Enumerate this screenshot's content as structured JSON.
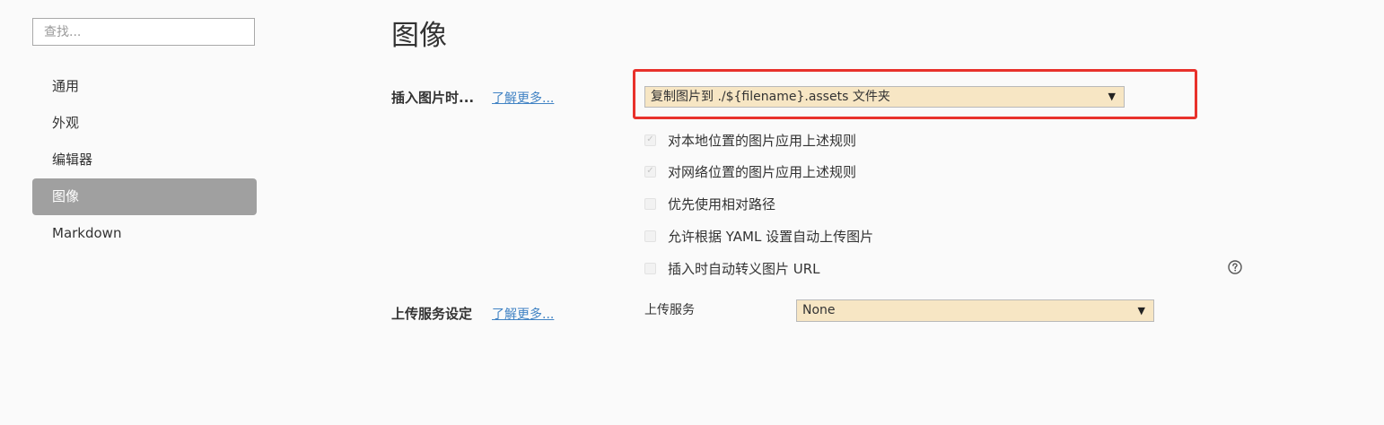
{
  "sidebar": {
    "search_placeholder": "查找...",
    "items": [
      {
        "label": "通用"
      },
      {
        "label": "外观"
      },
      {
        "label": "编辑器"
      },
      {
        "label": "图像",
        "active": true
      },
      {
        "label": "Markdown"
      }
    ]
  },
  "main": {
    "title": "图像",
    "insert_image": {
      "label": "插入图片时...",
      "learn_more": "了解更多...",
      "select_value": "复制图片到 ./${filename}.assets 文件夹",
      "options": [
        {
          "label": "对本地位置的图片应用上述规则",
          "checked": true,
          "disabled": true
        },
        {
          "label": "对网络位置的图片应用上述规则",
          "checked": true,
          "disabled": true
        },
        {
          "label": "优先使用相对路径",
          "checked": false,
          "disabled": true
        },
        {
          "label": "允许根据 YAML 设置自动上传图片",
          "checked": false,
          "disabled": true
        },
        {
          "label": "插入时自动转义图片 URL",
          "checked": false,
          "disabled": true
        }
      ]
    },
    "upload": {
      "label": "上传服务设定",
      "learn_more": "了解更多...",
      "field_label": "上传服务",
      "select_value": "None"
    }
  },
  "icons": {
    "dropdown": "caret-down-icon",
    "help": "question-circle-icon",
    "check": "checkmark-icon"
  },
  "colors": {
    "highlight": "#e8312b",
    "select_bg": "#f7e6c4",
    "active_nav_bg": "#a0a0a0",
    "link": "#4183c4"
  }
}
